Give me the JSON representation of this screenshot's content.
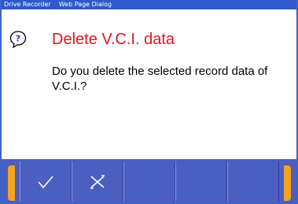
{
  "window": {
    "title_app": "Drive Recorder",
    "title_dialog": "Web Page Dialog"
  },
  "dialog": {
    "icon": "question-speech-icon",
    "title": "Delete V.C.I. data",
    "message": "Do you delete the selected record data of V.C.I.?"
  },
  "toolbar": {
    "buttons": [
      {
        "name": "ok-button",
        "icon": "checkmark-icon"
      },
      {
        "name": "cancel-button",
        "icon": "x-icon"
      },
      {
        "name": "blank-button-3",
        "icon": ""
      },
      {
        "name": "blank-button-4",
        "icon": ""
      },
      {
        "name": "blank-button-5",
        "icon": ""
      }
    ]
  },
  "colors": {
    "title_bar": "#2f59c9",
    "toolbar": "#4a5fc0",
    "accent_orange": "#f5a21c",
    "dialog_title": "#e0141e"
  }
}
